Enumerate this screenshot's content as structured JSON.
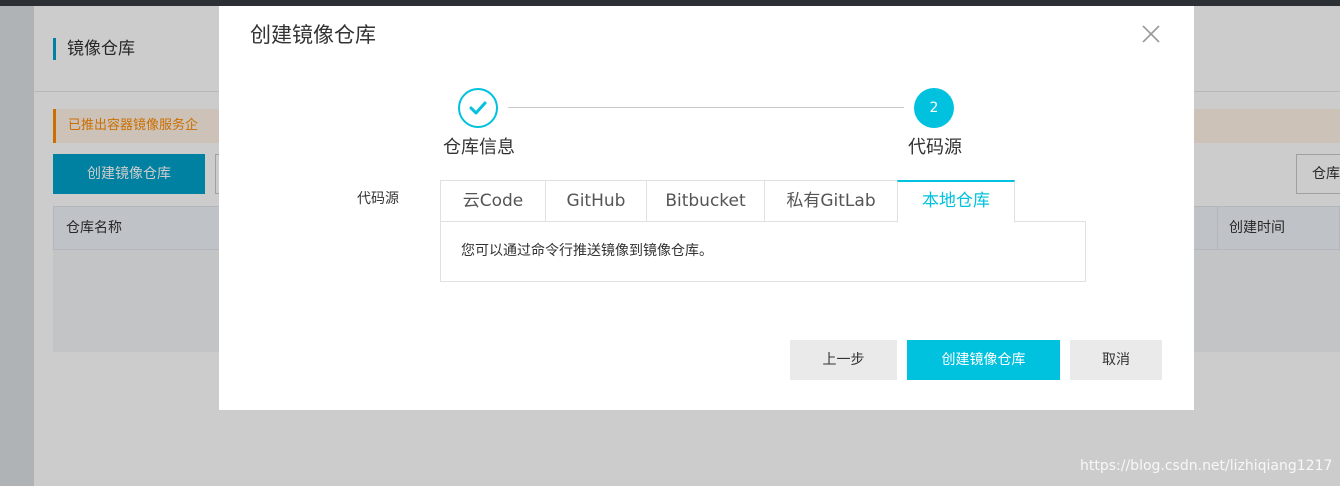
{
  "page": {
    "title": "镜像仓库",
    "notice": "已推出容器镜像服务企",
    "create_button": "创建镜像仓库",
    "right_button": "仓库",
    "table": {
      "col_name": "仓库名称",
      "col_time": "创建时间"
    }
  },
  "modal": {
    "title": "创建镜像仓库",
    "steps": [
      {
        "label": "仓库信息",
        "status": "done"
      },
      {
        "number": "2",
        "label": "代码源",
        "status": "active"
      }
    ],
    "source_label": "代码源",
    "tabs": [
      {
        "label": "云Code"
      },
      {
        "label": "GitHub"
      },
      {
        "label": "Bitbucket"
      },
      {
        "label": "私有GitLab"
      },
      {
        "label": "本地仓库",
        "active": true
      }
    ],
    "tab_content": "您可以通过命令行推送镜像到镜像仓库。",
    "buttons": {
      "prev": "上一步",
      "submit": "创建镜像仓库",
      "cancel": "取消"
    }
  },
  "watermark": "https://blog.csdn.net/lizhiqiang1217",
  "colors": {
    "accent": "#00c1de",
    "primary_bg_button": "#00a2ca",
    "notice_text": "#ff8a00"
  },
  "icons": {
    "close": "close-icon",
    "step_done": "check-icon"
  }
}
